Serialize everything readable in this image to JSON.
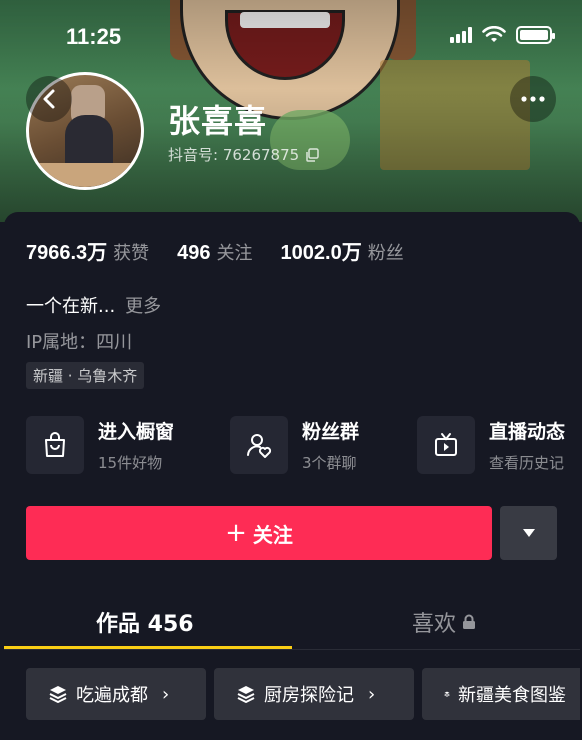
{
  "status_bar": {
    "time": "11:25"
  },
  "profile": {
    "name": "张喜喜",
    "douyin_id": "抖音号: 76267875"
  },
  "stats": [
    {
      "value": "7966.3万",
      "label": "获赞"
    },
    {
      "value": "496",
      "label": "关注"
    },
    {
      "value": "1002.0万",
      "label": "粉丝"
    }
  ],
  "bio": {
    "text": "一个在新...",
    "more": "更多"
  },
  "ip": "IP属地：四川",
  "location_tag": "新疆 · 乌鲁木齐",
  "features": [
    {
      "title": "进入橱窗",
      "subtitle": "15件好物",
      "icon": "shopping-bag-icon"
    },
    {
      "title": "粉丝群",
      "subtitle": "3个群聊",
      "icon": "fan-group-icon"
    },
    {
      "title": "直播动态",
      "subtitle": "查看历史记",
      "icon": "live-tv-icon"
    }
  ],
  "follow_button": {
    "plus": "+",
    "label": "关注"
  },
  "tabs": {
    "works": "作品 456",
    "likes": "喜欢"
  },
  "collections": [
    {
      "label": "吃遍成都"
    },
    {
      "label": "厨房探险记"
    },
    {
      "label": "新疆美食图鉴"
    }
  ],
  "colors": {
    "accent": "#fe2c55",
    "tab_indicator": "#face15",
    "background": "#161823"
  }
}
